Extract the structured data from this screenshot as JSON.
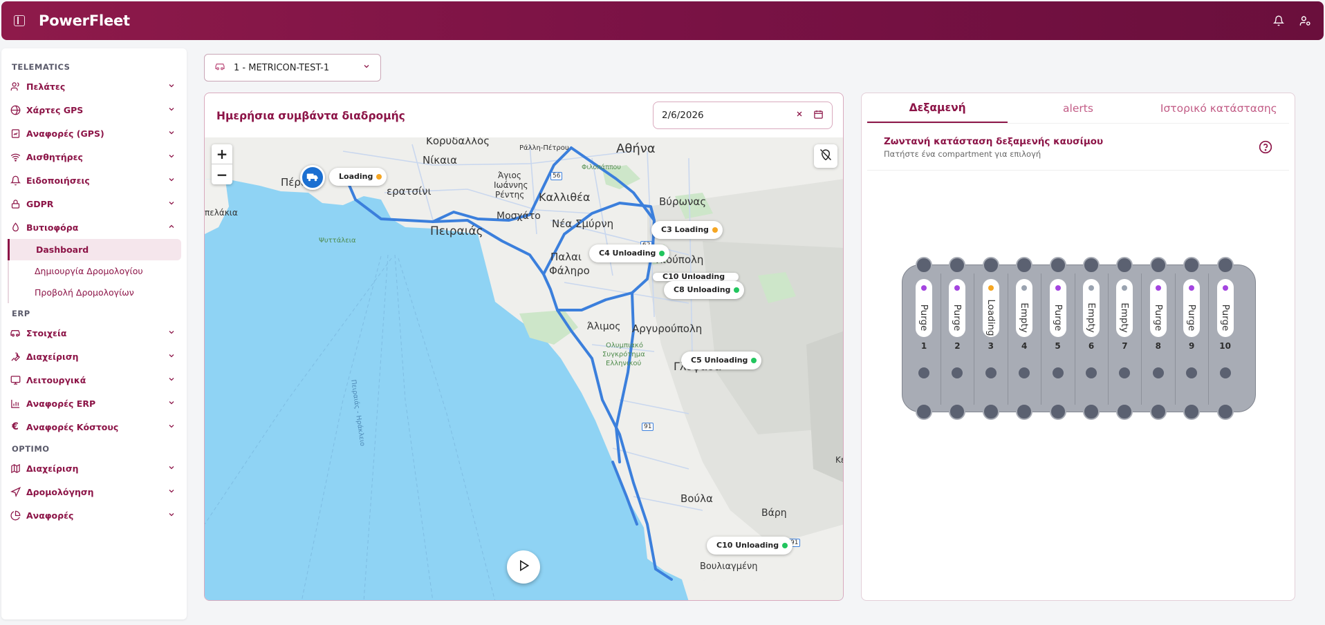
{
  "header": {
    "logo": "PowerFleet"
  },
  "sidebar": {
    "section_telematics": "TELEMATICS",
    "telematics_items": [
      {
        "label": "Πελάτες"
      },
      {
        "label": "Χάρτες GPS"
      },
      {
        "label": "Αναφορές (GPS)"
      },
      {
        "label": "Αισθητήρες"
      },
      {
        "label": "Ειδοποιήσεις"
      },
      {
        "label": "GDPR"
      },
      {
        "label": "Βυτιοφόρα"
      }
    ],
    "sub_items": [
      {
        "label": "Dashboard"
      },
      {
        "label": "Δημιουργία Δρομολογίου"
      },
      {
        "label": "Προβολή Δρομολογίων"
      }
    ],
    "section_erp": "ERP",
    "erp_items": [
      {
        "label": "Στοιχεία"
      },
      {
        "label": "Διαχείριση"
      },
      {
        "label": "Λειτουργικά"
      },
      {
        "label": "Αναφορές ERP"
      },
      {
        "label": "Αναφορές Κόστους"
      }
    ],
    "section_optimo": "OPTIMO",
    "optimo_items": [
      {
        "label": "Διαχείριση"
      },
      {
        "label": "Δρομολόγηση"
      },
      {
        "label": "Αναφορές"
      }
    ]
  },
  "vehicle_select": {
    "value": "1 - METRICON-TEST-1"
  },
  "map_card": {
    "title": "Ημερήσια συμβάντα διαδρομής",
    "date": "2/6/2026",
    "zoom_in": "+",
    "zoom_out": "−",
    "markers": [
      {
        "label": "Loading",
        "status_color": "#f5a623"
      },
      {
        "label": "C3 Loading",
        "status_color": "#f5a623"
      },
      {
        "label": "C4 Unloading",
        "status_color": "#22c55e"
      },
      {
        "label": "C10 Unloading",
        "status_color": "#22c55e"
      },
      {
        "label": "C8 Unloading",
        "status_color": "#22c55e"
      },
      {
        "label": "C5 Unloading",
        "status_color": "#22c55e"
      },
      {
        "label": "C10 Unloading",
        "status_color": "#22c55e"
      }
    ],
    "place_labels": {
      "athina": "Αθήνα",
      "nikaia": "Νίκαια",
      "korydallos": "Κορυδαλλός",
      "perama": "Πέραμα",
      "keratsini": "ερατσίνι",
      "peiraias": "Πειραιάς",
      "kallithea": "Καλλιθέα",
      "moschato": "Μοσχάτο",
      "nea_smyrni": "Νέα Σμύρνη",
      "palaio_faliro_1": "Παλαι",
      "palaio_faliro_2": "Φάληρο",
      "ilioupoli": "λιούπολη",
      "vyronas": "Βύρωνας",
      "alimos": "Άλιμος",
      "argyroupoli": "Αργυρούπολη",
      "glyfada": "Γλυφάδα",
      "voula": "Βούλα",
      "vari": "Βάρη",
      "vouliagmeni": "Βουλιαγμένη",
      "psyttaleia": "Ψυττάλεια",
      "pelakia": "πελάκια",
      "agios": "Άγιος",
      "ioannis": "Ιωάννης",
      "rentis": "Ρέντης",
      "filopappou": "Φιλοπάππου",
      "ralli": "Ράλλη-Πέτρου",
      "olympic_1": "Ολυμπιακό",
      "olympic_2": "Συγκρότημα",
      "olympic_3": "Ελληνικού",
      "route_56": "56",
      "route_91": "91",
      "route_62": "62",
      "lane": "Πειραιάς - Ηράκλειο",
      "ke": "Κε"
    }
  },
  "tank": {
    "tabs": [
      {
        "label": "Δεξαμενή"
      },
      {
        "label": "alerts"
      },
      {
        "label": "Ιστορικό κατάστασης"
      }
    ],
    "title": "Ζωντανή κατάσταση δεξαμενής καυσίμου",
    "subtitle": "Πατήστε ένα compartment για επιλογή",
    "compartments": [
      {
        "num": "1",
        "status": "Purge",
        "color": "#a445e0"
      },
      {
        "num": "2",
        "status": "Purge",
        "color": "#a445e0"
      },
      {
        "num": "3",
        "status": "Loading",
        "color": "#f5a623"
      },
      {
        "num": "4",
        "status": "Empty",
        "color": "#9aa3b0"
      },
      {
        "num": "5",
        "status": "Purge",
        "color": "#a445e0"
      },
      {
        "num": "6",
        "status": "Empty",
        "color": "#9aa3b0"
      },
      {
        "num": "7",
        "status": "Empty",
        "color": "#9aa3b0"
      },
      {
        "num": "8",
        "status": "Purge",
        "color": "#a445e0"
      },
      {
        "num": "9",
        "status": "Purge",
        "color": "#a445e0"
      },
      {
        "num": "10",
        "status": "Purge",
        "color": "#a445e0"
      }
    ]
  }
}
